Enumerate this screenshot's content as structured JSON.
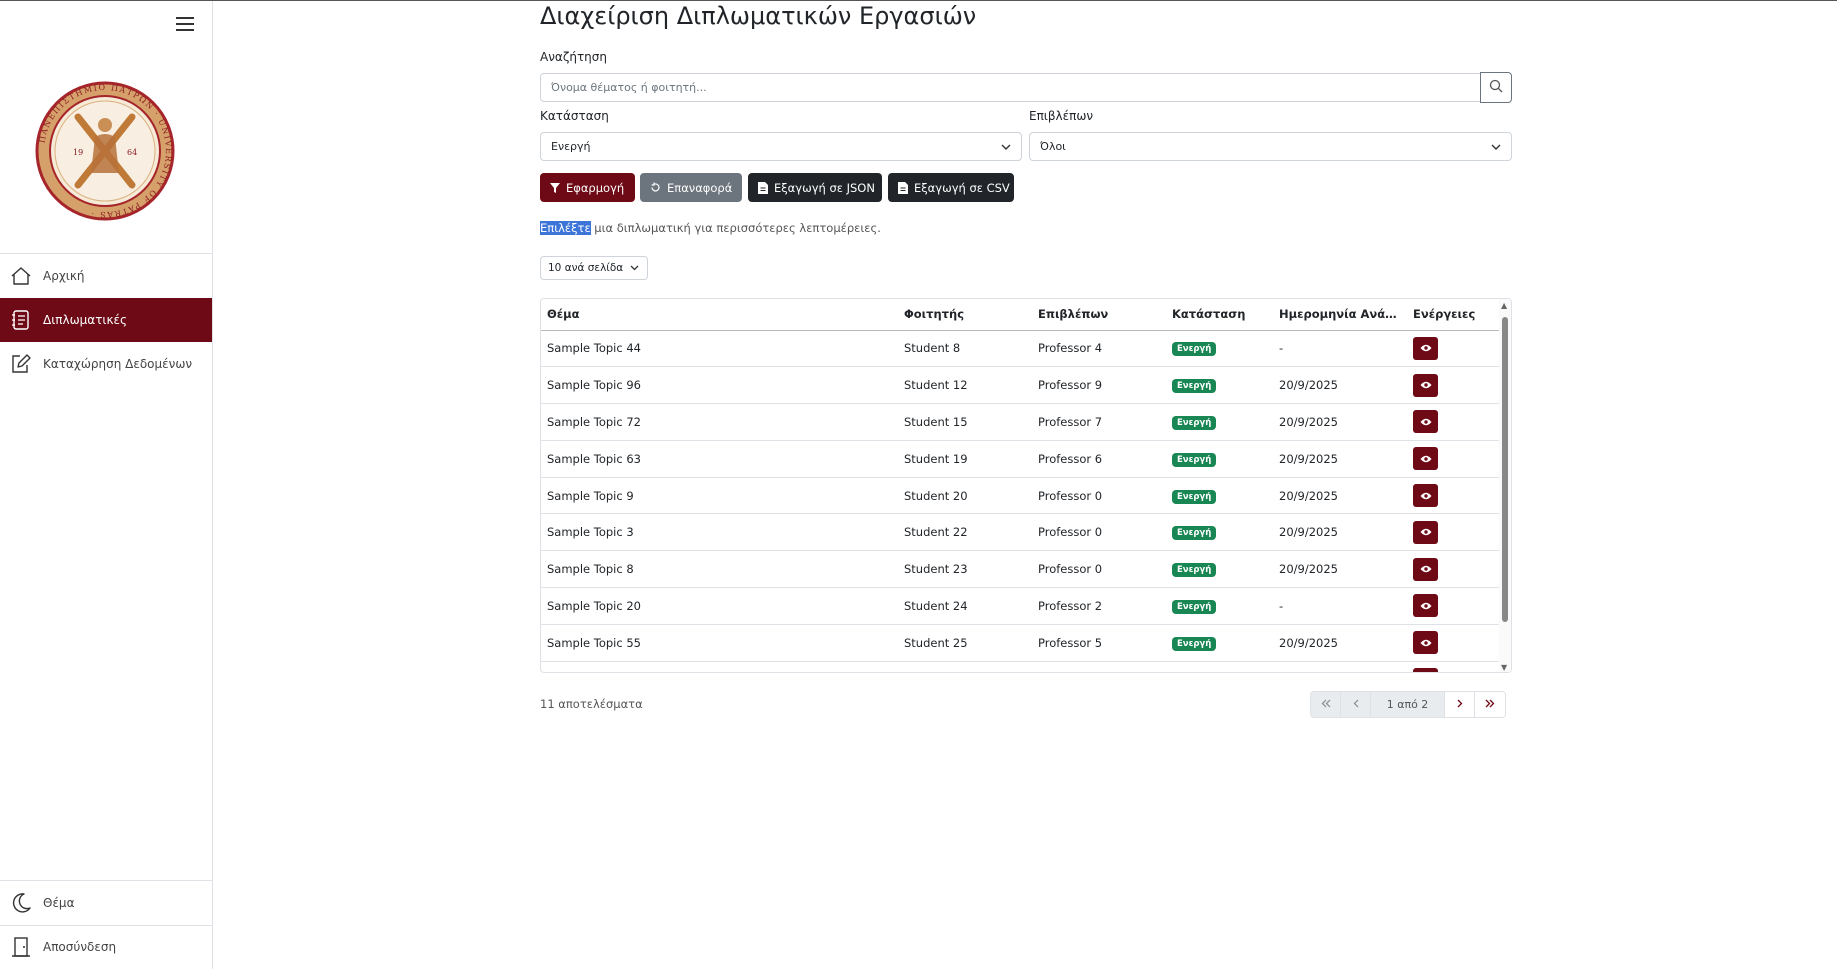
{
  "sidebar": {
    "logo_text": "ΠΑΝΕΠΙΣΤΗΜΙΟ ΠΑΤΡΩΝ · UNIVERSITY OF PATRAS · 19 64",
    "items": [
      {
        "label": "Αρχική",
        "icon": "home-icon"
      },
      {
        "label": "Διπλωματικές",
        "icon": "journal-icon",
        "active": true
      },
      {
        "label": "Καταχώρηση Δεδομένων",
        "icon": "pencil-square-icon"
      }
    ],
    "bottom_items": [
      {
        "label": "Θέμα",
        "icon": "moon-icon"
      },
      {
        "label": "Αποσύνδεση",
        "icon": "door-icon"
      }
    ]
  },
  "main": {
    "title": "Διαχείριση Διπλωματικών Εργασιών",
    "search": {
      "label": "Αναζήτηση",
      "placeholder": "Όνομα θέματος ή φοιτητή..."
    },
    "status_filter": {
      "label": "Κατάσταση",
      "value": "Ενεργή"
    },
    "supervisor_filter": {
      "label": "Επιβλέπων",
      "value": "Όλοι"
    },
    "buttons": {
      "apply": "Εφαρμογή",
      "reset": "Επαναφορά",
      "export_json": "Εξαγωγή σε JSON",
      "export_csv": "Εξαγωγή σε CSV"
    },
    "info_highlight": "Επιλέξτε",
    "info_rest": " μια διπλωματική για περισσότερες λεπτομέρειες.",
    "per_page": "10 ανά σελίδα",
    "table": {
      "headers": [
        "Θέμα",
        "Φοιτητής",
        "Επιβλέπων",
        "Κατάσταση",
        "Ημερομηνία Ανάθεσης",
        "Ενέργειες"
      ],
      "rows": [
        {
          "topic": "Sample Topic 44",
          "student": "Student 8",
          "supervisor": "Professor 4",
          "status": "Ενεργή",
          "date": "-"
        },
        {
          "topic": "Sample Topic 96",
          "student": "Student 12",
          "supervisor": "Professor 9",
          "status": "Ενεργή",
          "date": "20/9/2025"
        },
        {
          "topic": "Sample Topic 72",
          "student": "Student 15",
          "supervisor": "Professor 7",
          "status": "Ενεργή",
          "date": "20/9/2025"
        },
        {
          "topic": "Sample Topic 63",
          "student": "Student 19",
          "supervisor": "Professor 6",
          "status": "Ενεργή",
          "date": "20/9/2025"
        },
        {
          "topic": "Sample Topic 9",
          "student": "Student 20",
          "supervisor": "Professor 0",
          "status": "Ενεργή",
          "date": "20/9/2025"
        },
        {
          "topic": "Sample Topic 3",
          "student": "Student 22",
          "supervisor": "Professor 0",
          "status": "Ενεργή",
          "date": "20/9/2025"
        },
        {
          "topic": "Sample Topic 8",
          "student": "Student 23",
          "supervisor": "Professor 0",
          "status": "Ενεργή",
          "date": "20/9/2025"
        },
        {
          "topic": "Sample Topic 20",
          "student": "Student 24",
          "supervisor": "Professor 2",
          "status": "Ενεργή",
          "date": "-"
        },
        {
          "topic": "Sample Topic 55",
          "student": "Student 25",
          "supervisor": "Professor 5",
          "status": "Ενεργή",
          "date": "20/9/2025"
        },
        {
          "topic": "",
          "student": "",
          "supervisor": "",
          "status": "",
          "date": ""
        }
      ]
    },
    "results": "11 αποτελέσματα",
    "pagination": {
      "info": "1 από 2"
    }
  },
  "colors": {
    "primary": "#6d0a16",
    "success": "#198754",
    "dark": "#212529",
    "secondary": "#6c757d"
  }
}
